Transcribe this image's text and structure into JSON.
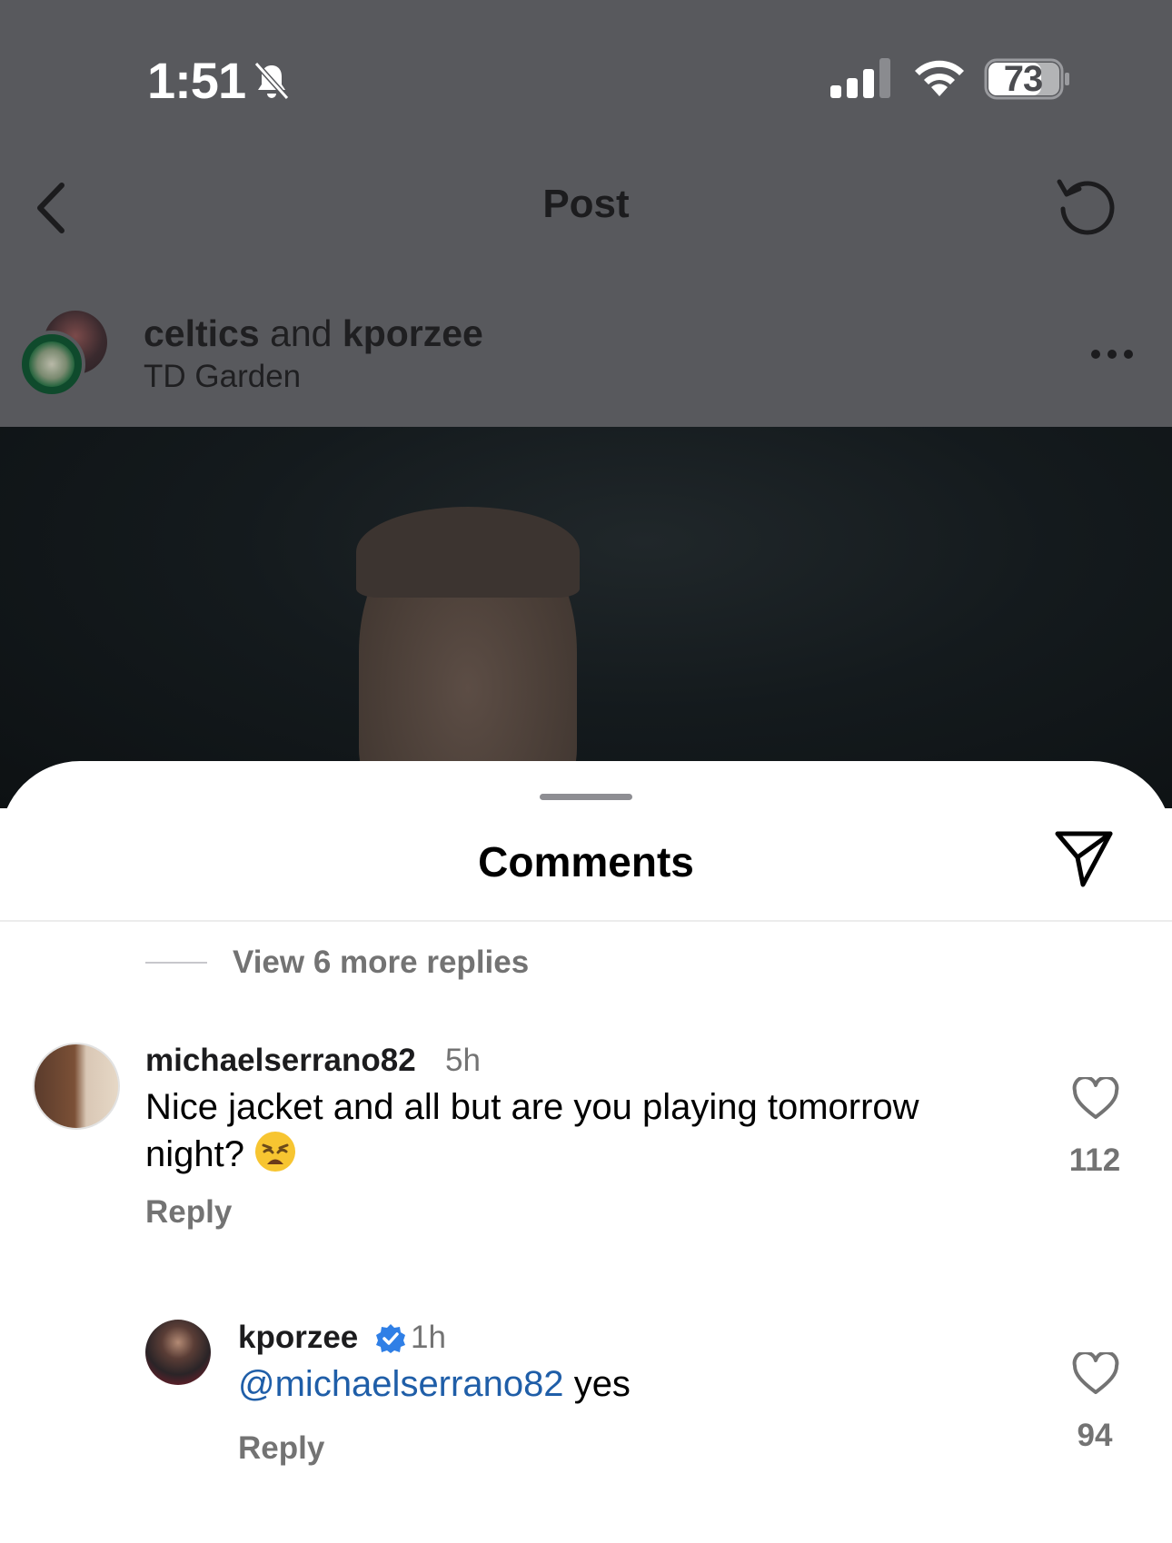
{
  "status_bar": {
    "time": "1:51",
    "battery": "73"
  },
  "nav": {
    "title": "Post"
  },
  "post": {
    "author_1": "celtics",
    "joiner": "and",
    "author_2": "kporzee",
    "location": "TD Garden"
  },
  "comments_sheet": {
    "title": "Comments",
    "view_more_replies": "View 6 more replies",
    "comments": [
      {
        "username": "michaelserrano82",
        "time": "5h",
        "text_line1": "Nice jacket and all but are you playing tomorrow",
        "text_line2": "night?",
        "reply_label": "Reply",
        "likes": "112"
      },
      {
        "username": "kporzee",
        "verified": true,
        "time": "1h",
        "mention": "@michaelserrano82",
        "text": "yes",
        "reply_label": "Reply",
        "likes": "94"
      }
    ]
  },
  "colors": {
    "dim_overlay": "#58595d",
    "mention": "#1f5ea8",
    "verified": "#2f7fe6",
    "secondary_text": "#737373"
  }
}
